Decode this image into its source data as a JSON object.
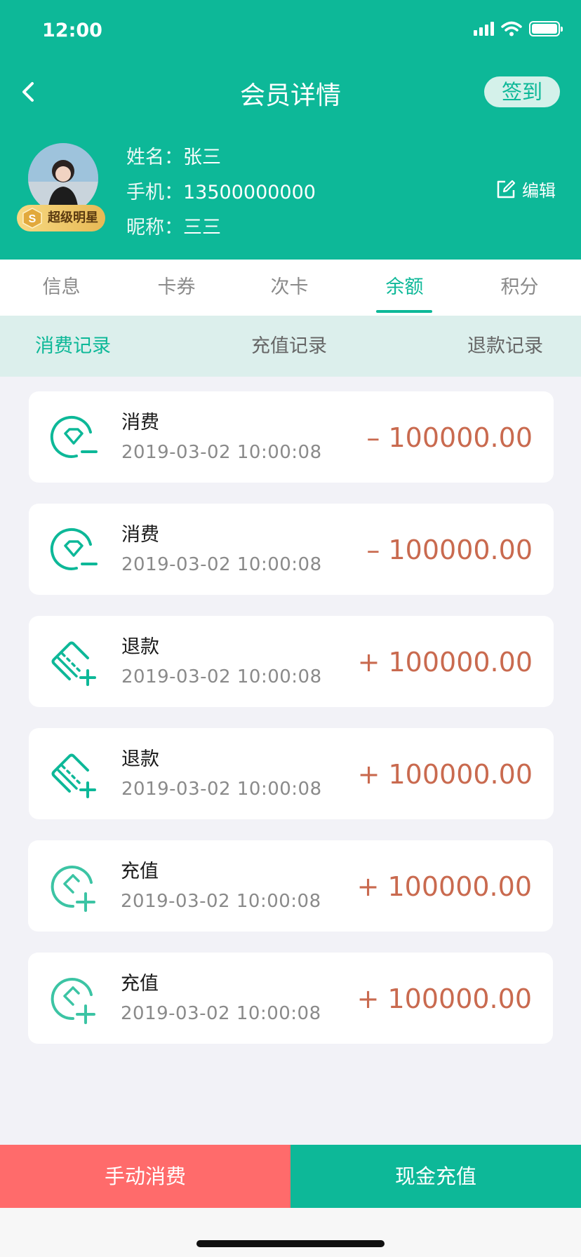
{
  "status_bar": {
    "time": "12:00"
  },
  "nav": {
    "title": "会员详情",
    "sign_in_label": "签到"
  },
  "profile": {
    "badge": "超级明星",
    "name_label": "姓名：",
    "name": "张三",
    "phone_label": "手机：",
    "phone": "13500000000",
    "nickname_label": "昵称：",
    "nickname": "三三",
    "edit_label": "编辑"
  },
  "tabs": [
    {
      "label": "信息",
      "active": false
    },
    {
      "label": "卡券",
      "active": false
    },
    {
      "label": "次卡",
      "active": false
    },
    {
      "label": "余额",
      "active": true
    },
    {
      "label": "积分",
      "active": false
    }
  ],
  "subtabs": [
    {
      "label": "消费记录",
      "active": true
    },
    {
      "label": "充值记录",
      "active": false
    },
    {
      "label": "退款记录",
      "active": false
    }
  ],
  "records": [
    {
      "type": "消费",
      "time": "2019-03-02   10:00:08",
      "amount": "– 100000.00",
      "icon": "diamond-minus-icon"
    },
    {
      "type": "消费",
      "time": "2019-03-02   10:00:08",
      "amount": "– 100000.00",
      "icon": "diamond-minus-icon"
    },
    {
      "type": "退款",
      "time": "2019-03-02   10:00:08",
      "amount": "+ 100000.00",
      "icon": "card-plus-icon"
    },
    {
      "type": "退款",
      "time": "2019-03-02   10:00:08",
      "amount": "+ 100000.00",
      "icon": "card-plus-icon"
    },
    {
      "type": "充值",
      "time": "2019-03-02   10:00:08",
      "amount": "+ 100000.00",
      "icon": "tag-plus-icon"
    },
    {
      "type": "充值",
      "time": "2019-03-02   10:00:08",
      "amount": "+ 100000.00",
      "icon": "tag-plus-icon"
    }
  ],
  "actions": {
    "manual_consume": "手动消费",
    "cash_recharge": "现金充值"
  },
  "colors": {
    "primary": "#0db898",
    "danger": "#ff6b6b",
    "amount": "#c96a4f"
  }
}
